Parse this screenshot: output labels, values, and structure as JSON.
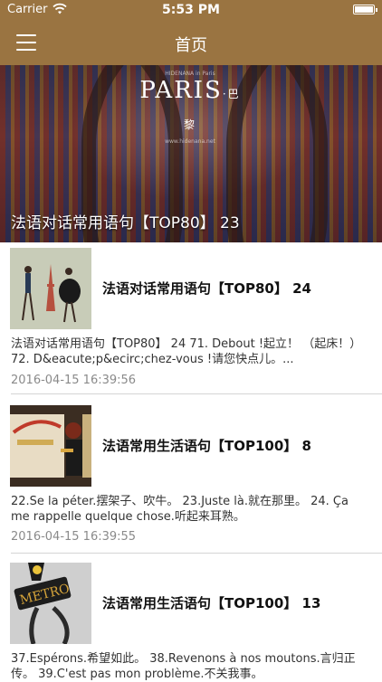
{
  "status_bar": {
    "carrier": "Carrier",
    "time": "5:53 PM"
  },
  "nav": {
    "title": "首页"
  },
  "hero": {
    "logo_text": "PARIS",
    "logo_cn": "·巴黎",
    "logo_top": "HIDENANA in Paris",
    "logo_url": "www.hidenana.net",
    "caption": "法语对话常用语句【TOP80】 23"
  },
  "articles": [
    {
      "title": "法语对话常用语句【TOP80】 24",
      "excerpt": "法语对话常用语句【TOP80】 24 71. Debout !起立！ （起床！） 72. D&eacute;p&ecirc;chez-vous !请您快点儿。...",
      "date": "2016-04-15 16:39:56",
      "thumb_icon": "couple-eiffel-illustration"
    },
    {
      "title": "法语常用生活语句【TOP100】 8",
      "excerpt": "22.Se la péter.摆架子、吹牛。 23.Juste là.就在那里。 24. Ça me rappelle quelque chose.听起来耳熟。",
      "date": "2016-04-15 16:39:55",
      "thumb_icon": "metro-poster-illustration"
    },
    {
      "title": "法语常用生活语句【TOP100】 13",
      "excerpt": "37.Espérons.希望如此。 38.Revenons à nos moutons.言归正传。 39.C'est pas mon problème.不关我事。",
      "date": "",
      "thumb_icon": "metro-sign-photo"
    }
  ]
}
